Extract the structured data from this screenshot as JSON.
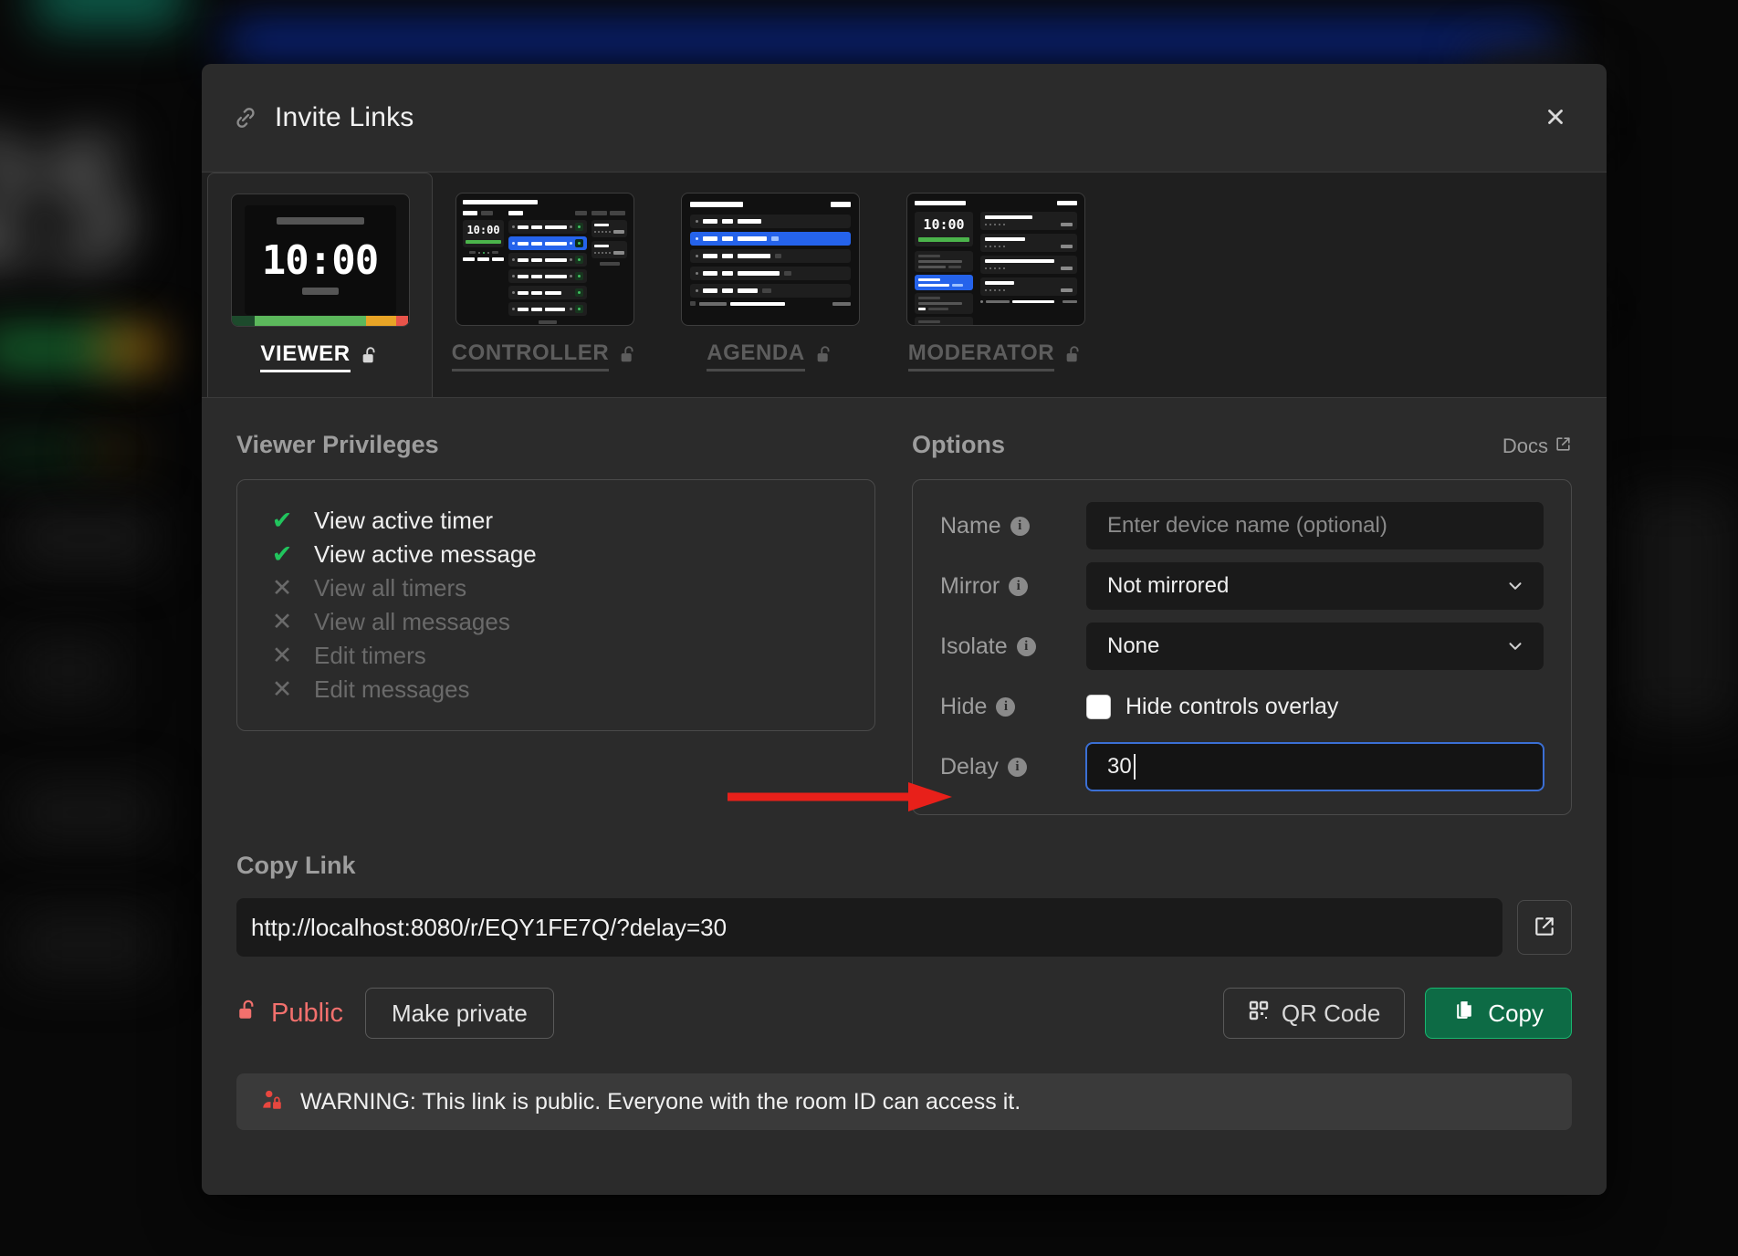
{
  "background": {
    "timer_digits": "25"
  },
  "modal": {
    "title": "Invite Links",
    "link_icon": "link-icon",
    "close_icon": "close-icon"
  },
  "tabs": [
    {
      "id": "viewer",
      "label": "VIEWER",
      "active": true,
      "lock_icon": "unlock-icon",
      "thumb_time": "10:00"
    },
    {
      "id": "controller",
      "label": "CONTROLLER",
      "active": false,
      "lock_icon": "unlock-icon",
      "thumb_time": "10:00"
    },
    {
      "id": "agenda",
      "label": "AGENDA",
      "active": false,
      "lock_icon": "unlock-icon",
      "thumb_time": ""
    },
    {
      "id": "moderator",
      "label": "MODERATOR",
      "active": false,
      "lock_icon": "unlock-icon",
      "thumb_time": "10:00"
    }
  ],
  "privileges": {
    "title": "Viewer Privileges",
    "items": [
      {
        "label": "View active timer",
        "granted": true,
        "icon": "check-icon"
      },
      {
        "label": "View active message",
        "granted": true,
        "icon": "check-icon"
      },
      {
        "label": "View all timers",
        "granted": false,
        "icon": "cross-icon"
      },
      {
        "label": "View all messages",
        "granted": false,
        "icon": "cross-icon"
      },
      {
        "label": "Edit timers",
        "granted": false,
        "icon": "cross-icon"
      },
      {
        "label": "Edit messages",
        "granted": false,
        "icon": "cross-icon"
      }
    ]
  },
  "options": {
    "title": "Options",
    "docs_label": "Docs",
    "docs_icon": "external-link-icon",
    "name": {
      "label": "Name",
      "value": "",
      "placeholder": "Enter device name (optional)",
      "info_icon": "info-icon"
    },
    "mirror": {
      "label": "Mirror",
      "value": "Not mirrored",
      "info_icon": "info-icon",
      "chevron_icon": "chevron-down-icon"
    },
    "isolate": {
      "label": "Isolate",
      "value": "None",
      "info_icon": "info-icon",
      "chevron_icon": "chevron-down-icon"
    },
    "hide": {
      "label": "Hide",
      "checkbox_label": "Hide controls overlay",
      "checked": false,
      "info_icon": "info-icon"
    },
    "delay": {
      "label": "Delay",
      "value": "30",
      "info_icon": "info-icon",
      "focused": true
    }
  },
  "copy_link": {
    "title": "Copy Link",
    "url": "http://localhost:8080/r/EQY1FE7Q/?delay=30",
    "open_icon": "open-external-icon"
  },
  "actions": {
    "visibility_label": "Public",
    "visibility_icon": "unlock-icon",
    "make_private_label": "Make private",
    "qr_label": "QR Code",
    "qr_icon": "qr-code-icon",
    "copy_label": "Copy",
    "copy_icon": "copy-icon"
  },
  "warning": {
    "icon": "user-lock-icon",
    "text": "WARNING: This link is public. Everyone with the room ID can access it."
  },
  "colors": {
    "accent_green": "#18b870",
    "danger_red": "#e8473f",
    "public_red": "#f2706d",
    "focus_blue": "#3b6fd4",
    "select_blue": "#2563eb",
    "annotation_red": "#e8201a"
  }
}
